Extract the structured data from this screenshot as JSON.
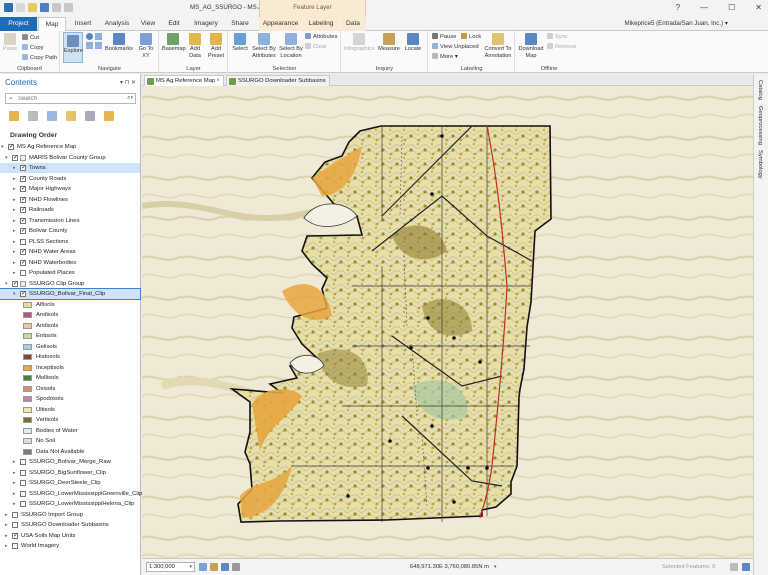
{
  "window": {
    "title": "MS_AG_SSURGO - MS Ag Reference Map - ArcGIS Pro",
    "context_band": "Feature Layer",
    "controls": [
      "?",
      "—",
      "☐",
      "✕"
    ]
  },
  "tabs": [
    "Project",
    "Map",
    "Insert",
    "Analysis",
    "View",
    "Edit",
    "Imagery",
    "Share",
    "Appearance",
    "Labeling",
    "Data"
  ],
  "user": "Mikeprice5 (Entrada/San Juan, Inc.) ▾",
  "ribbon": {
    "clipboard": {
      "paste": "Paste",
      "cut": "Cut",
      "copy": "Copy",
      "copy_path": "Copy Path",
      "label": "Clipboard"
    },
    "navigate": {
      "explore": "Explore",
      "bookmarks": "Bookmarks",
      "go_to_xy": "Go To XY",
      "label": "Navigate"
    },
    "layer": {
      "basemap": "Basemap",
      "add_data": "Add Data",
      "add_preset": "Add Preset",
      "label": "Layer"
    },
    "selection": {
      "select": "Select",
      "by_attributes": "Select By Attributes",
      "by_location": "Select By Location",
      "attributes": "Attributes",
      "clear": "Clear",
      "label": "Selection"
    },
    "inquiry": {
      "infographics": "Infographics",
      "measure": "Measure",
      "locate": "Locate",
      "label": "Inquiry"
    },
    "labeling": {
      "pause": "Pause",
      "lock": "Lock",
      "view_unplaced": "View Unplaced",
      "more": "More ▾",
      "convert": "Convert To Annotation",
      "label": "Labeling"
    },
    "offline": {
      "download": "Download Map",
      "sync": "Sync",
      "remove": "Remove",
      "label": "Offline"
    }
  },
  "contents": {
    "title": "Contents",
    "search_placeholder": "Search",
    "drawing_order": "Drawing Order",
    "map_name": "MS Ag Reference Map",
    "group1": "MARIS Bolivar County Group",
    "layers1": [
      {
        "name": "Towns",
        "checked": true,
        "selected": true
      },
      {
        "name": "County Roads",
        "checked": true
      },
      {
        "name": "Major Highways",
        "checked": true
      },
      {
        "name": "NHD Flowlines",
        "checked": true
      },
      {
        "name": "Railroads",
        "checked": true
      },
      {
        "name": "Transmission Lines",
        "checked": true
      },
      {
        "name": "Bolivar County",
        "checked": true
      },
      {
        "name": "PLSS Sections",
        "checked": false
      },
      {
        "name": "NHD Water Areas",
        "checked": true
      },
      {
        "name": "NHD Waterbodies",
        "checked": true
      },
      {
        "name": "Populated Places",
        "checked": false
      }
    ],
    "group2": "SSURGO Clip Group",
    "active_layer": "SSURGO_Bolivar_Final_Clip",
    "legend": [
      {
        "label": "Alfisols",
        "color": "#e4df9c"
      },
      {
        "label": "Andisols",
        "color": "#b0577a"
      },
      {
        "label": "Aridisols",
        "color": "#ecc99a"
      },
      {
        "label": "Entisols",
        "color": "#c6dd96"
      },
      {
        "label": "Gelisols",
        "color": "#a5cfe0"
      },
      {
        "label": "Histosols",
        "color": "#7d4738"
      },
      {
        "label": "Inceptisols",
        "color": "#ebac3e"
      },
      {
        "label": "Mollisols",
        "color": "#49843f"
      },
      {
        "label": "Oxisols",
        "color": "#d98f6f"
      },
      {
        "label": "Spodosols",
        "color": "#c583b0"
      },
      {
        "label": "Ultisols",
        "color": "#f0e6a8"
      },
      {
        "label": "Vertisols",
        "color": "#7b6d2a"
      },
      {
        "label": "Bodies of Water",
        "color": "#d6eef5"
      },
      {
        "label": "No Soil",
        "color": "#dedede"
      },
      {
        "label": "Data Not Available",
        "color": "#7c7c7c"
      }
    ],
    "layers2": [
      {
        "name": "SSURGO_Bolivar_Merge_Raw",
        "checked": false
      },
      {
        "name": "SSURGO_BigSunflower_Clip",
        "checked": false
      },
      {
        "name": "SSURGO_DeerSteele_Clip",
        "checked": false
      },
      {
        "name": "SSURGO_LowerMississippiGreenville_Clip",
        "checked": false
      },
      {
        "name": "SSURGO_LowerMississippiHelena_Clip",
        "checked": false
      }
    ],
    "bottom_layers": [
      {
        "name": "SSURGO Import Group",
        "checked": false
      },
      {
        "name": "SSURGO Downloader Subbasins",
        "checked": false
      },
      {
        "name": "USA Soils Map Units",
        "checked": true
      },
      {
        "name": "World Imagery",
        "checked": false
      }
    ]
  },
  "map_tabs": [
    "MS Ag Reference Map",
    "SSURGO Downloader Subbasins"
  ],
  "right_panes": [
    "Catalog",
    "Geoprocessing",
    "Symbology"
  ],
  "status": {
    "scale": "1:300,000",
    "coords": "648,971.30E 3,760,080.85N m",
    "selected": "Selected Features: 0"
  }
}
